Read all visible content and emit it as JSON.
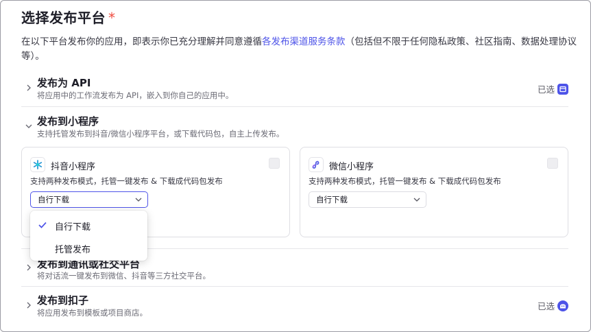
{
  "header": {
    "title": "选择发布平台",
    "required_mark": "*"
  },
  "description": {
    "prefix": "在以下平台发布你的应用，即表示你已充分理解并同意遵循",
    "link": "各发布渠道服务条款",
    "suffix": "（包括但不限于任何隐私政策、社区指南、数据处理协议等）。"
  },
  "sections": [
    {
      "title": "发布为 API",
      "subtitle": "将应用中的工作流发布为 API，嵌入到你自己的应用中。",
      "selected_label": "已选",
      "expanded": false
    },
    {
      "title": "发布到小程序",
      "subtitle": "支持托管发布到抖音/微信小程序平台，或下载代码包，自主上传发布。",
      "expanded": true
    },
    {
      "title": "发布到通讯或社交平台",
      "subtitle": "将对话流一键发布到微信、抖音等三方社交平台。",
      "expanded": false
    },
    {
      "title": "发布到扣子",
      "subtitle": "将应用发布到模板或项目商店。",
      "selected_label": "已选",
      "expanded": false
    }
  ],
  "mini_programs": [
    {
      "name": "抖音小程序",
      "desc": "支持两种发布模式，托管一键发布 & 下载成代码包发布",
      "mode": "自行下载",
      "icon": "douyin-icon"
    },
    {
      "name": "微信小程序",
      "desc": "支持两种发布模式，托管一键发布 & 下载成代码包发布",
      "mode": "自行下载",
      "icon": "wechat-miniprogram-icon"
    }
  ],
  "dropdown": {
    "options": [
      "自行下载",
      "托管发布"
    ],
    "selected": "自行下载"
  },
  "colors": {
    "accent": "#4d53e8",
    "required": "#ef4b3f"
  }
}
